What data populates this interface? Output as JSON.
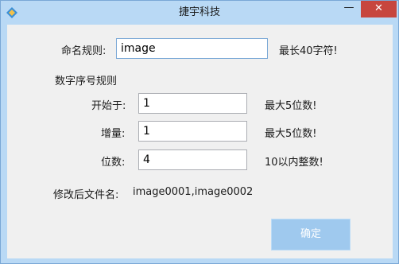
{
  "window": {
    "title": "捷宇科技",
    "minimize_glyph": "—",
    "close_glyph": "✕",
    "app_icon": "app-logo-icon"
  },
  "form": {
    "naming_rule": {
      "label": "命名规则:",
      "value": "image",
      "hint": "最长40字符!"
    },
    "number_rule_heading": "数字序号规则",
    "start_at": {
      "label": "开始于:",
      "value": "1",
      "hint": "最大5位数!"
    },
    "increment": {
      "label": "增量:",
      "value": "1",
      "hint": "最大5位数!"
    },
    "digits": {
      "label": "位数:",
      "value": "4",
      "hint": "10以内整数!"
    },
    "preview": {
      "label": "修改后文件名:",
      "value": "image0001,image0002"
    }
  },
  "buttons": {
    "ok_label": "确定"
  },
  "colors": {
    "title_bar": "#b9d9f5",
    "close_button": "#c7463e",
    "ok_button": "#9fc9ee",
    "client_bg": "#f0f0f0"
  }
}
